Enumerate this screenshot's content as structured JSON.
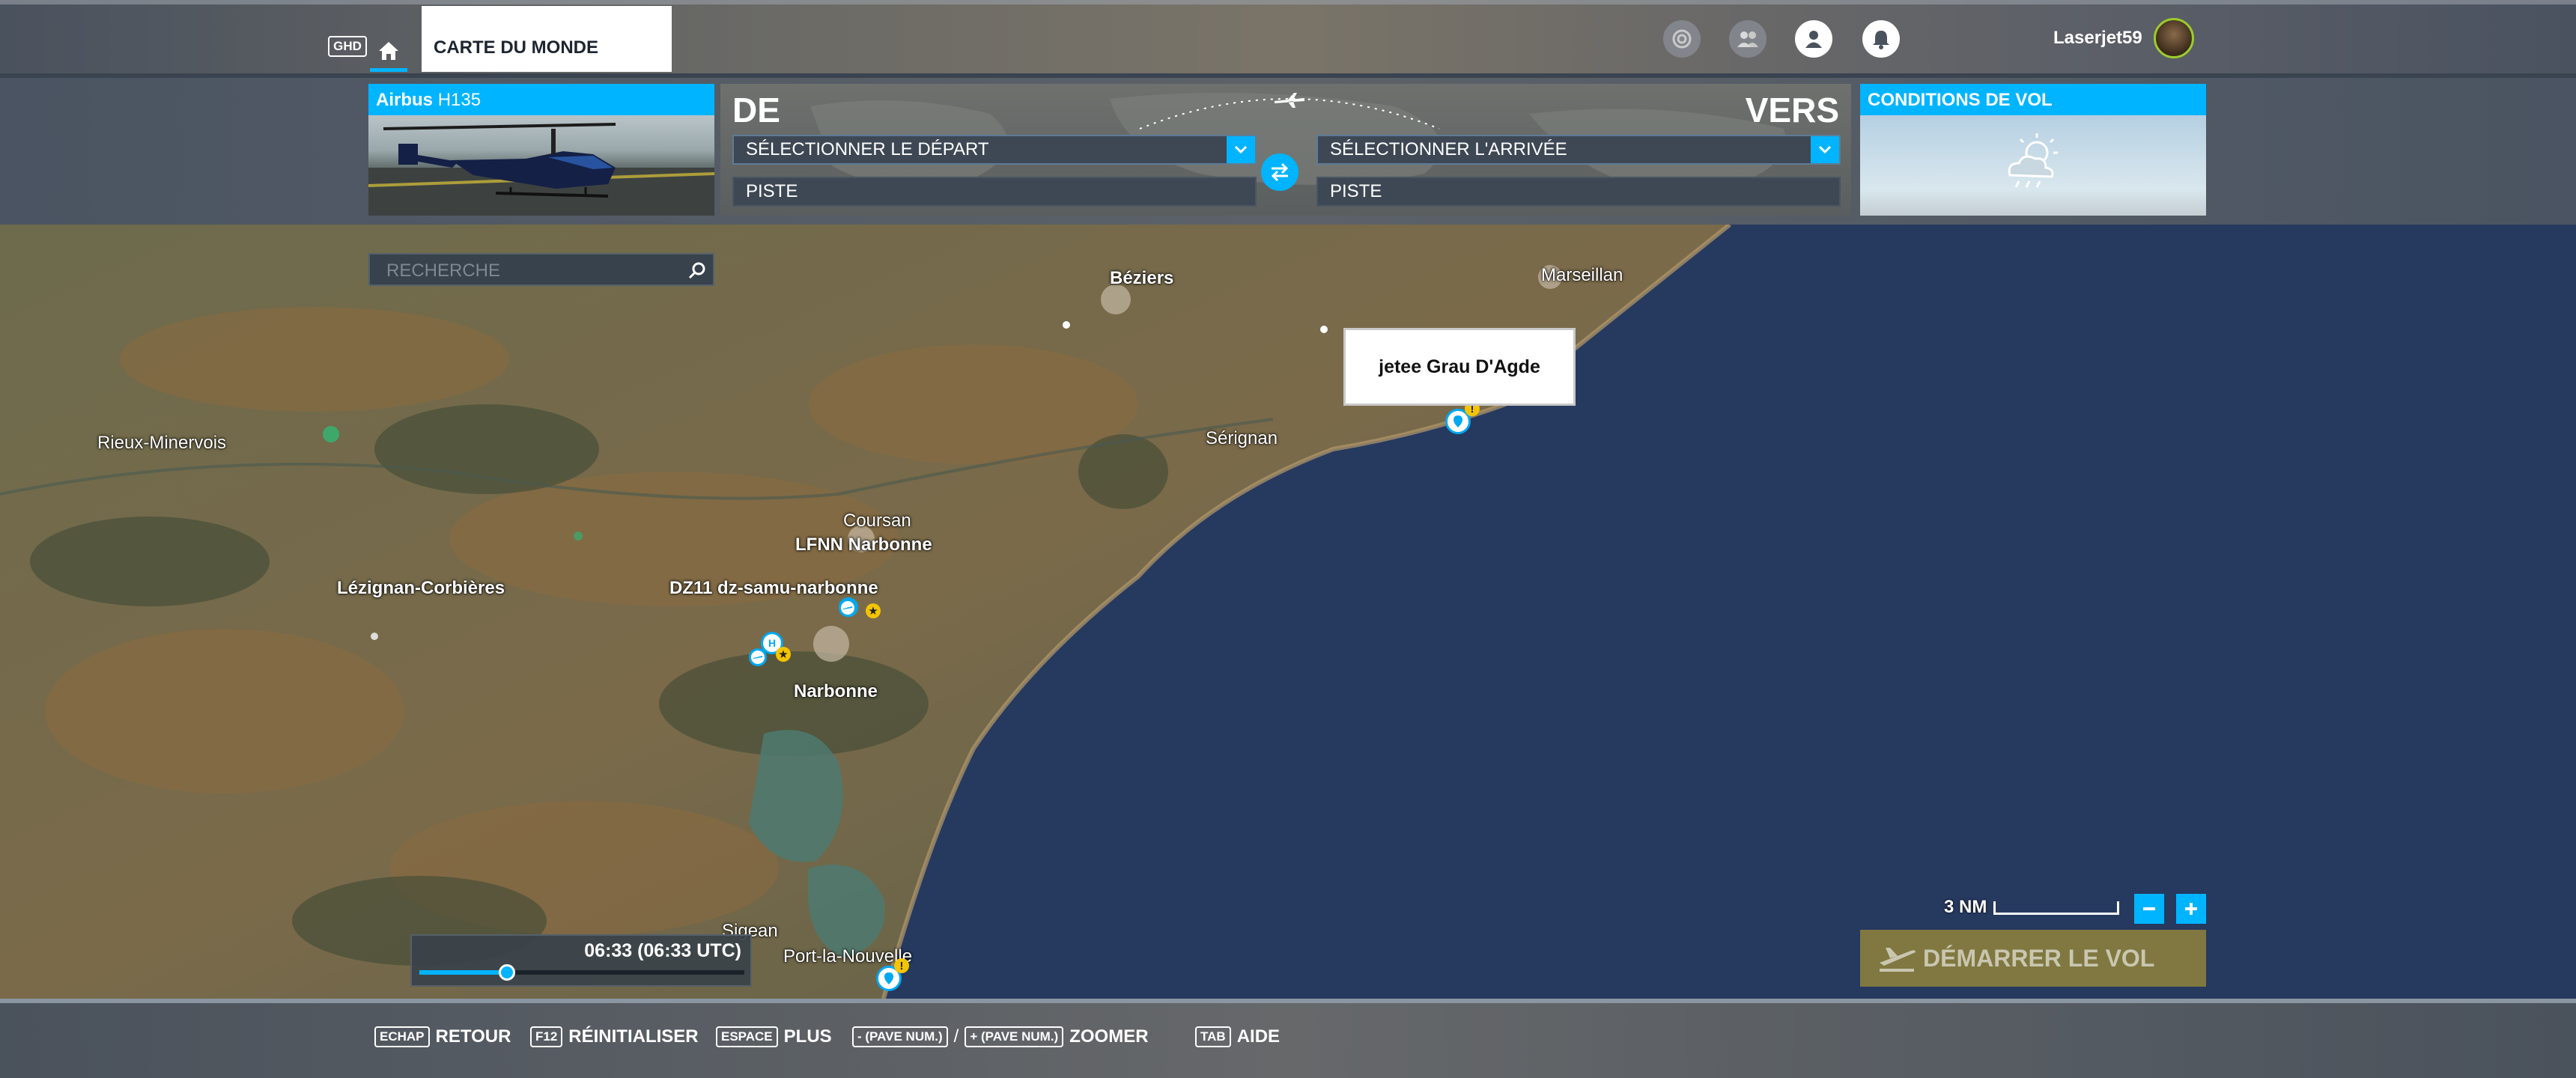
{
  "topbar": {
    "ghd_key": "GHD",
    "world_tab": "CARTE DU MONDE",
    "username": "Laserjet59"
  },
  "aircraft": {
    "make": "Airbus",
    "model": "H135"
  },
  "route": {
    "from_label": "DE",
    "to_label": "VERS",
    "departure_select": "SÉLECTIONNER LE DÉPART",
    "arrival_select": "SÉLECTIONNER L'ARRIVÉE",
    "departure_runway": "PISTE",
    "arrival_runway": "PISTE"
  },
  "weather": {
    "title": "CONDITIONS DE VOL"
  },
  "search": {
    "placeholder": "RECHERCHE"
  },
  "map": {
    "labels": {
      "beziers": "Béziers",
      "marseillan": "Marseillan",
      "serignan": "Sérignan",
      "rieux": "Rieux-Minervois",
      "lezignan": "Lézignan-Corbières",
      "coursan": "Coursan",
      "lfnn": "LFNN Narbonne",
      "dz11": "DZ11 dz-samu-narbonne",
      "narbonne": "Narbonne",
      "sigean": "Sigean",
      "port_la_nouvelle": "Port-la-Nouvelle"
    },
    "tooltip": "jetee Grau D'Agde",
    "scale": "3 NM"
  },
  "time": {
    "value": "06:33 (06:33 UTC)",
    "progress": 0.27
  },
  "start_button": "DÉMARRER LE VOL",
  "hints": {
    "back_key": "ECHAP",
    "back_label": "RETOUR",
    "reset_key": "F12",
    "reset_label": "RÉINITIALISER",
    "more_key": "ESPACE",
    "more_label": "PLUS",
    "zoom_out_key": "- (PAVE NUM.)",
    "zoom_sep": "/",
    "zoom_in_key": "+ (PAVE NUM.)",
    "zoom_label": "ZOOMER",
    "help_key": "TAB",
    "help_label": "AIDE"
  },
  "colors": {
    "accent": "#00b4ff",
    "sea": "#26395f",
    "start_button": "#887e3e"
  }
}
